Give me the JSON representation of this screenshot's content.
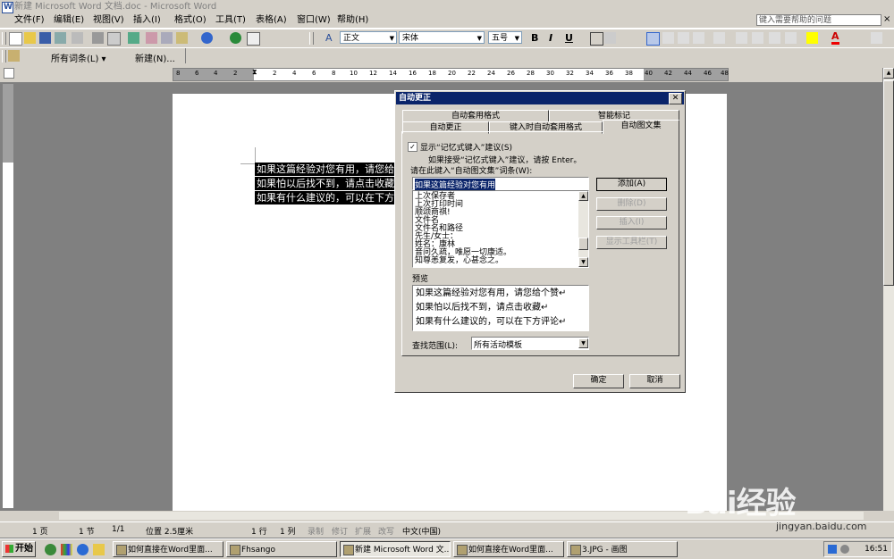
{
  "window": {
    "title": "新建 Microsoft Word 文档.doc - Microsoft Word"
  },
  "menu": {
    "items": [
      "文件(F)",
      "编辑(E)",
      "视图(V)",
      "插入(I)",
      "格式(O)",
      "工具(T)",
      "表格(A)",
      "窗口(W)",
      "帮助(H)"
    ],
    "help_placeholder": "键入需要帮助的问题",
    "close": "×"
  },
  "toolbar": {
    "style_value": "正文",
    "font_value": "宋体",
    "size_value": "五号",
    "bold": "B",
    "italic": "I",
    "underline": "U",
    "font_color": "A",
    "autotext_all": "所有词条(L) ▾",
    "autotext_new": "新建(N)..."
  },
  "ruler": {
    "numbers": [
      "8",
      "6",
      "4",
      "2",
      "2",
      "4",
      "6",
      "8",
      "10",
      "12",
      "14",
      "16",
      "18",
      "20",
      "22",
      "24",
      "26",
      "28",
      "30",
      "32",
      "34",
      "36",
      "38",
      "40",
      "42",
      "44",
      "46",
      "48"
    ]
  },
  "document": {
    "lines": [
      "如果这篇经验对您有用，请您给个赞",
      "如果怕以后找不到，请点击收藏",
      "如果有什么建议的，可以在下方评论"
    ]
  },
  "dialog": {
    "title": "自动更正",
    "tabs_row1": [
      "自动套用格式",
      "智能标记"
    ],
    "tabs_row2": [
      "自动更正",
      "键入时自动套用格式",
      "自动图文集"
    ],
    "active_tab": "自动图文集",
    "show_suggestion_label": "显示“记忆式键入”建议(S)",
    "show_suggestion_checked": true,
    "hint": "如果接受“记忆式键入”建议，请按 Enter。",
    "enter_label": "请在此键入“自动图文集”词条(W):",
    "entry_value": "如果这篇经验对您有用",
    "entries": [
      "上次保存者",
      "上次打印时间",
      "顺颂商祺!",
      "文件名",
      "文件名和路径",
      "先生/女士：",
      "姓名：康林",
      "音问久疏，唯愿一切康适。",
      "知尊恙复发，心甚念之。"
    ],
    "buttons": {
      "add": "添加(A)",
      "delete": "删除(D)",
      "insert": "插入(I)",
      "show_toolbar": "显示工具栏(T)"
    },
    "preview_label": "预览",
    "preview_lines": [
      "如果这篇经验对您有用，请您给个赞↵",
      "如果怕以后找不到，请点击收藏↵",
      "如果有什么建议的，可以在下方评论↵"
    ],
    "scope_label": "查找范围(L):",
    "scope_value": "所有活动模板",
    "ok": "确定",
    "cancel": "取消"
  },
  "status": {
    "page": "1 页",
    "section": "1 节",
    "page_of": "1/1",
    "position": "位置 2.5厘米",
    "line": "1 行",
    "column": "1 列",
    "rec": "录制",
    "trk": "修订",
    "ext": "扩展",
    "ovr": "改写",
    "lang": "中文(中国)"
  },
  "taskbar": {
    "start": "开始",
    "tasks": [
      "如何直接在Word里面...",
      "Fhsango",
      "新建 Microsoft Word 文...",
      "如何直接在Word里面...",
      "3.JPG - 画图"
    ],
    "clock": "16:51"
  },
  "watermark": {
    "brand": "Bai经验",
    "url": "jingyan.baidu.com"
  },
  "colors": {
    "face": "#d4d0c8",
    "title_active": "#0a246a",
    "selection": "#000000"
  }
}
